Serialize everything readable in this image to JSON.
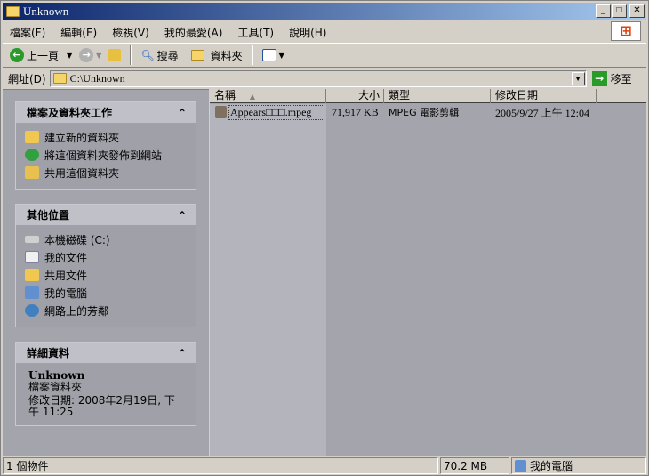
{
  "window": {
    "title": "Unknown"
  },
  "menu": [
    "檔案(F)",
    "編輯(E)",
    "檢視(V)",
    "我的最愛(A)",
    "工具(T)",
    "說明(H)"
  ],
  "toolbar": {
    "back": "上一頁",
    "search": "搜尋",
    "folders": "資料夾"
  },
  "address": {
    "label": "網址(D)",
    "value": "C:\\Unknown",
    "go": "移至"
  },
  "tasks": {
    "title": "檔案及資料夾工作",
    "items": [
      "建立新的資料夾",
      "將這個資料夾發佈到網站",
      "共用這個資料夾"
    ]
  },
  "places": {
    "title": "其他位置",
    "items": [
      "本機磁碟 (C:)",
      "我的文件",
      "共用文件",
      "我的電腦",
      "網路上的芳鄰"
    ]
  },
  "details": {
    "title": "詳細資料",
    "name": "Unknown",
    "type": "檔案資料夾",
    "modified": "修改日期: 2008年2月19日, 下午 11:25"
  },
  "columns": [
    "名稱",
    "大小",
    "類型",
    "修改日期"
  ],
  "files": [
    {
      "name": "Appears□□□.mpeg",
      "size": "71,917 KB",
      "type": "MPEG 電影剪輯",
      "modified": "2005/9/27 上午 12:04"
    }
  ],
  "status": {
    "count": "1 個物件",
    "size": "70.2 MB",
    "location": "我的電腦"
  },
  "colors": {
    "title_start": "#0a246a",
    "title_end": "#a6caf0",
    "face": "#d4d0c8"
  }
}
